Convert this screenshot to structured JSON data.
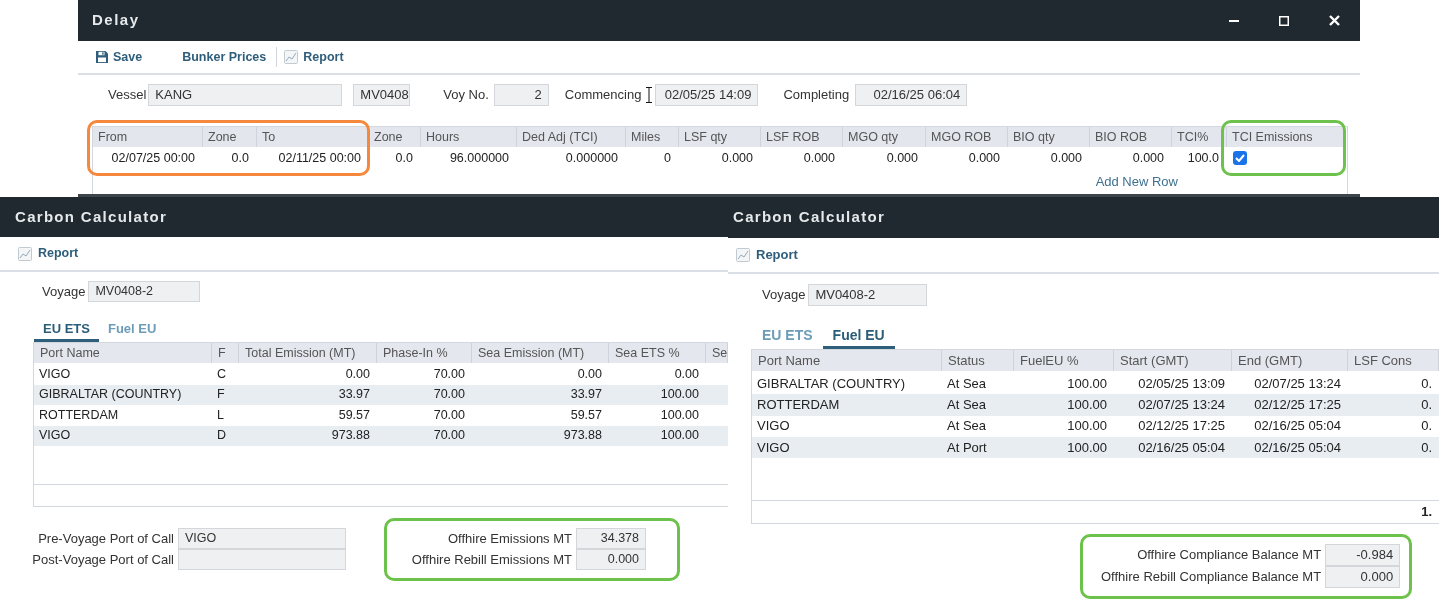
{
  "delay_window": {
    "title": "Delay",
    "toolbar": [
      {
        "kind": "save",
        "label": "Save"
      },
      {
        "kind": "plain",
        "label": "Bunker Prices"
      },
      {
        "kind": "report",
        "label": "Report"
      }
    ],
    "vessel": {
      "label": "Vessel",
      "value": "KANG",
      "code": "MV0408"
    },
    "voy_no": {
      "label": "Voy No.",
      "value": "2"
    },
    "commencing": {
      "label": "Commencing",
      "value": "02/05/25 14:09"
    },
    "completing": {
      "label": "Completing",
      "value": "02/16/25 06:04"
    },
    "table": {
      "columns": [
        {
          "label": "From",
          "color": "#f5883c"
        },
        {
          "label": "Zone",
          "color": "#f5883c"
        },
        {
          "label": "To",
          "color": "#f5883c"
        },
        {
          "label": "Zone"
        },
        {
          "label": "Hours"
        },
        {
          "label": "Ded Adj (TCI)"
        },
        {
          "label": "Miles"
        },
        {
          "label": "LSF qty"
        },
        {
          "label": "LSF ROB"
        },
        {
          "label": "MGO qty"
        },
        {
          "label": "MGO ROB"
        },
        {
          "label": "BIO qty"
        },
        {
          "label": "BIO ROB"
        },
        {
          "label": "TCI%"
        },
        {
          "label": "TCI Emissions",
          "color": "#6cc24a"
        }
      ],
      "rows": [
        {
          "cells": [
            "02/07/25 00:00",
            "0.0",
            "02/11/25 00:00",
            "0.0",
            "96.000000",
            "0.000000",
            "0",
            "0.000",
            "0.000",
            "0.000",
            "0.000",
            "0.000",
            "0.000",
            "100.0"
          ],
          "tci_emissions": true
        }
      ],
      "add_row": "Add New Row"
    }
  },
  "carbon_calculators": [
    {
      "title": "Carbon Calculator",
      "report": "Report",
      "voyage": {
        "label": "Voyage",
        "value": "MV0408-2"
      },
      "tabs": [
        {
          "label": "EU ETS",
          "selected": true
        },
        {
          "label": "Fuel EU",
          "selected": false
        }
      ],
      "table": {
        "columns": [
          "Port Name",
          "F",
          "Total Emission (MT)",
          "Phase-In %",
          "Sea Emission (MT)",
          "Sea ETS %",
          "Se"
        ],
        "rows": [
          [
            "VIGO",
            "C",
            "0.00",
            "70.00",
            "0.00",
            "0.00"
          ],
          [
            "GIBRALTAR (COUNTRY)",
            "F",
            "33.97",
            "70.00",
            "33.97",
            "100.00"
          ],
          [
            "ROTTERDAM",
            "L",
            "59.57",
            "70.00",
            "59.57",
            "100.00"
          ],
          [
            "VIGO",
            "D",
            "973.88",
            "70.00",
            "973.88",
            "100.00"
          ]
        ]
      },
      "port_of_call": [
        {
          "label": "Pre-Voyage Port of Call",
          "value": "VIGO"
        },
        {
          "label": "Post-Voyage Port of Call"
        }
      ],
      "offhire": {
        "color": "#6cc24a",
        "fields": [
          {
            "label": "Offhire Emissions MT",
            "value": "34.378"
          },
          {
            "label": "Offhire Rebill Emissions MT",
            "value": "0.000"
          }
        ]
      }
    },
    {
      "title": "Carbon Calculator",
      "report": "Report",
      "voyage": {
        "label": "Voyage",
        "value": "MV0408-2"
      },
      "tabs": [
        {
          "label": "EU ETS",
          "selected": false
        },
        {
          "label": "Fuel EU",
          "selected": true
        }
      ],
      "table": {
        "columns": [
          "Port Name",
          "Status",
          "FuelEU %",
          "Start (GMT)",
          "End (GMT)",
          "LSF Cons"
        ],
        "rows": [
          [
            "GIBRALTAR (COUNTRY)",
            "At Sea",
            "100.00",
            "02/05/25 13:09",
            "02/07/25 13:24",
            "0."
          ],
          [
            "ROTTERDAM",
            "At Sea",
            "100.00",
            "02/07/25 13:24",
            "02/12/25 17:25",
            "0."
          ],
          [
            "VIGO",
            "At Sea",
            "100.00",
            "02/12/25 17:25",
            "02/16/25 05:04",
            "0."
          ],
          [
            "VIGO",
            "At Port",
            "100.00",
            "02/16/25 05:04",
            "02/16/25 05:04",
            "0."
          ]
        ],
        "total": "1."
      },
      "offhire": {
        "color": "#6cc24a",
        "fields": [
          {
            "label": "Offhire Compliance Balance MT",
            "value": "-0.984"
          },
          {
            "label": "Offhire Rebill Compliance Balance MT",
            "value": "0.000"
          }
        ]
      }
    }
  ]
}
